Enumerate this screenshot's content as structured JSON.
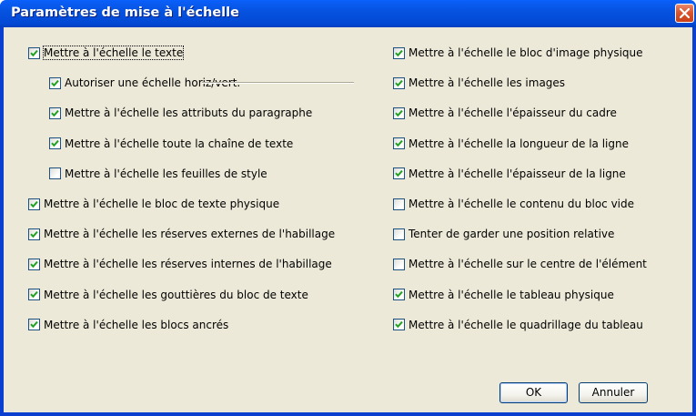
{
  "window": {
    "title": "Paramètres de mise à l'échelle"
  },
  "left_column": [
    {
      "label": "Mettre à l'échelle le texte",
      "checked": true,
      "indent": 0
    },
    {
      "label": "Autoriser une échelle horiz/vert.",
      "checked": true,
      "indent": 1
    },
    {
      "label": "Mettre à l'échelle les attributs du paragraphe",
      "checked": true,
      "indent": 1
    },
    {
      "label": "Mettre à l'échelle toute la chaîne de texte",
      "checked": true,
      "indent": 1
    },
    {
      "label": "Mettre à l'échelle les feuilles de style",
      "checked": false,
      "indent": 1
    },
    {
      "label": "Mettre à l'échelle le bloc de texte physique",
      "checked": true,
      "indent": 0
    },
    {
      "label": "Mettre à l'échelle les réserves externes de l'habillage",
      "checked": true,
      "indent": 0
    },
    {
      "label": "Mettre à l'échelle les réserves internes de l'habillage",
      "checked": true,
      "indent": 0
    },
    {
      "label": "Mettre à l'échelle les gouttières du bloc de texte",
      "checked": true,
      "indent": 0
    },
    {
      "label": "Mettre à l'échelle les blocs ancrés",
      "checked": true,
      "indent": 0
    }
  ],
  "right_column": [
    {
      "label": "Mettre à l'échelle le bloc d'image physique",
      "checked": true
    },
    {
      "label": "Mettre à l'échelle les images",
      "checked": true
    },
    {
      "label": "Mettre à l'échelle l'épaisseur du cadre",
      "checked": true
    },
    {
      "label": "Mettre à l'échelle la longueur de la ligne",
      "checked": true
    },
    {
      "label": "Mettre à l'échelle l'épaisseur de la ligne",
      "checked": true
    },
    {
      "label": "Mettre à l'échelle le contenu du bloc vide",
      "checked": false
    },
    {
      "label": "Tenter de garder une position relative",
      "checked": false
    },
    {
      "label": "Mettre à l'échelle sur le centre de l'élément",
      "checked": false
    },
    {
      "label": "Mettre à l'échelle le tableau physique",
      "checked": true
    },
    {
      "label": "Mettre à l'échelle le quadrillage du tableau",
      "checked": true
    }
  ],
  "buttons": {
    "ok": "OK",
    "cancel": "Annuler"
  },
  "colors": {
    "titlebar": "#0653e0",
    "dialog_bg": "#ece9d8",
    "checkmark": "#21a121",
    "close": "#d9552f"
  }
}
